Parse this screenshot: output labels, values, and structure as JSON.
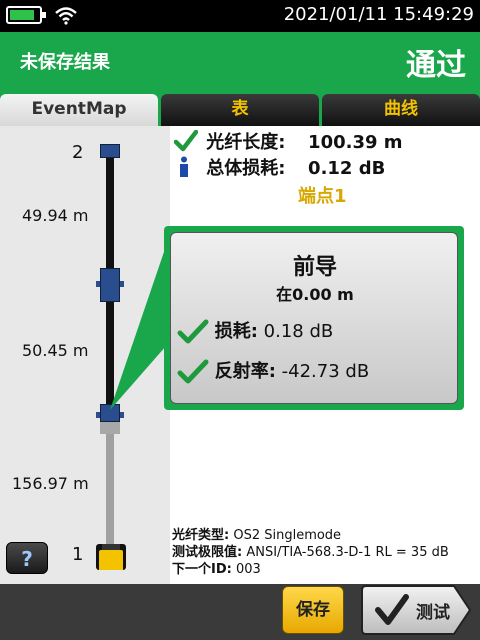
{
  "status_bar": {
    "datetime": "2021/01/11  15:49:29"
  },
  "header": {
    "unsaved_label": "未保存结果",
    "result": "通过"
  },
  "tabs": [
    {
      "label": "EventMap",
      "active": true
    },
    {
      "label": "表",
      "active": false
    },
    {
      "label": "曲线",
      "active": false
    }
  ],
  "event_map": {
    "end_labels": {
      "far": "2",
      "near": "1"
    },
    "segments": [
      "49.94 m",
      "50.45 m",
      "156.97 m"
    ]
  },
  "summary": {
    "fiber_length_label": "光纤长度:",
    "fiber_length_value": "100.39 m",
    "total_loss_label": "总体损耗:",
    "total_loss_value": "0.12 dB",
    "endpoint": "端点1"
  },
  "event_card": {
    "title": "前导",
    "position": "在0.00 m",
    "loss_label": "损耗:",
    "loss_value": " 0.18 dB",
    "reflectance_label": "反射率:",
    "reflectance_value": " -42.73 dB"
  },
  "details": {
    "fiber_type_label": "光纤类型:",
    "fiber_type_value": " OS2 Singlemode",
    "limit_label": "测试极限值:",
    "limit_value": " ANSI/TIA-568.3-D-1 RL = 35 dB",
    "next_id_label": "下一个ID:",
    "next_id_value": " 003"
  },
  "buttons": {
    "help": "?",
    "save": "保存",
    "test": "测试"
  },
  "colors": {
    "header_green": "#1aa64a",
    "accent_yellow": "#f3c300",
    "connector_blue": "#2a4d8f"
  }
}
